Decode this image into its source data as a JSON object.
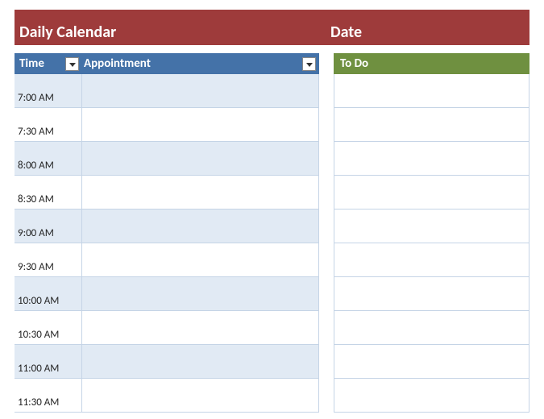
{
  "header": {
    "title_left": "Daily Calendar",
    "title_right": "Date"
  },
  "columns": {
    "time_label": "Time",
    "appointment_label": "Appointment",
    "todo_label": "To Do"
  },
  "rows": [
    {
      "time": "7:00 AM",
      "appointment": "",
      "todo": ""
    },
    {
      "time": "7:30 AM",
      "appointment": "",
      "todo": ""
    },
    {
      "time": "8:00 AM",
      "appointment": "",
      "todo": ""
    },
    {
      "time": "8:30 AM",
      "appointment": "",
      "todo": ""
    },
    {
      "time": "9:00 AM",
      "appointment": "",
      "todo": ""
    },
    {
      "time": "9:30 AM",
      "appointment": "",
      "todo": ""
    },
    {
      "time": "10:00 AM",
      "appointment": "",
      "todo": ""
    },
    {
      "time": "10:30 AM",
      "appointment": "",
      "todo": ""
    },
    {
      "time": "11:00 AM",
      "appointment": "",
      "todo": ""
    },
    {
      "time": "11:30 AM",
      "appointment": "",
      "todo": ""
    }
  ]
}
